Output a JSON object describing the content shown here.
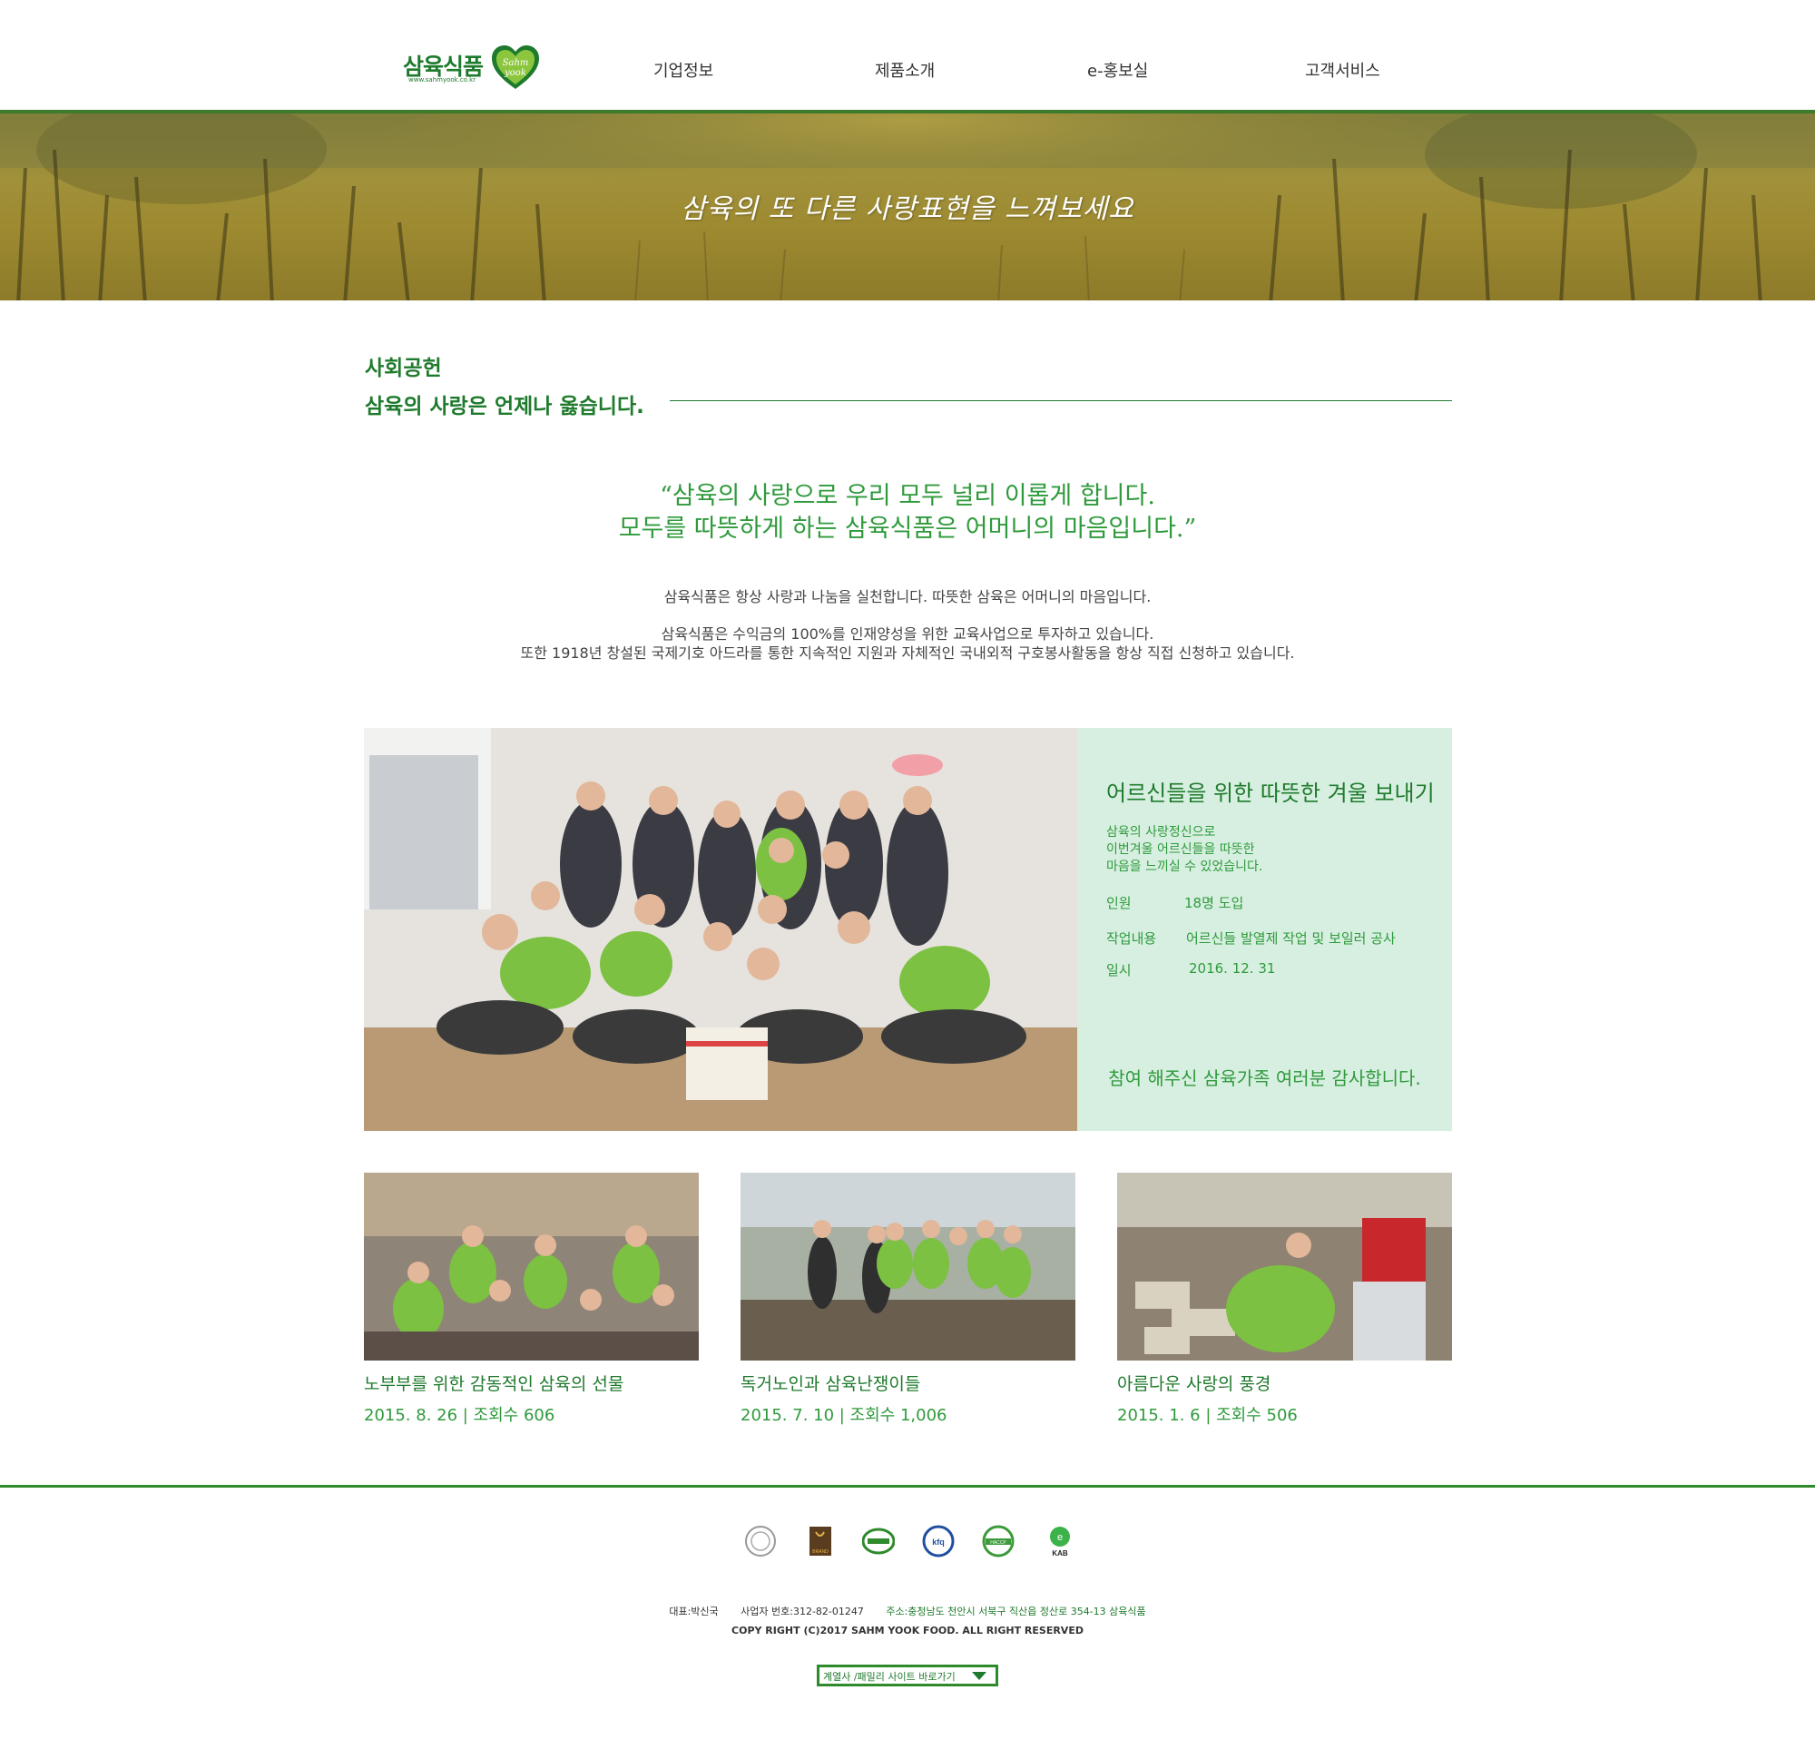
{
  "header": {
    "logo_text": "삼육식품",
    "logo_url": "www.sahmyook.co.kr",
    "logo_badge": "Sahm yook",
    "nav": [
      "기업정보",
      "제품소개",
      "e-홍보실",
      "고객서비스"
    ]
  },
  "banner": {
    "text": "삼육의 또 다른 사랑표현을 느껴보세요"
  },
  "section": {
    "title": "사회공헌",
    "subtitle": "삼육의 사랑은 언제나 옳습니다.",
    "quote_line1": "“삼육의 사랑으로 우리 모두 널리 이롭게 합니다.",
    "quote_line2": "모두를 따뜻하게 하는 삼육식품은 어머니의 마음입니다.”",
    "para1": "삼육식품은 항상 사랑과 나눔을 실천합니다. 따뜻한 삼육은 어머니의 마음입니다.",
    "para2": "삼육식품은 수익금의 100%를 인재양성을 위한 교육사업으로 투자하고 있습니다.",
    "para3": "또한 1918년 창설된 국제기호 아드라를 통한 지속적인 지원과 자체적인 국내외적 구호봉사활동을 항상 직접 신청하고 있습니다."
  },
  "feature": {
    "title": "어르신들을 위한 따뜻한 겨울 보내기",
    "desc_line1": "삼육의 사랑정신으로",
    "desc_line2": "이번겨울 어르신들을 따뜻한",
    "desc_line3": "마음을 느끼실 수 있었습니다.",
    "rows": [
      {
        "label": "인원",
        "value": "18명 도입"
      },
      {
        "label": "작업내용",
        "value": "어르신들 발열제 작업 및 보일러 공사"
      },
      {
        "label": "일시",
        "value": "2016. 12. 31"
      }
    ],
    "thanks": "참여 해주신 삼육가족 여러분 감사합니다."
  },
  "cards": [
    {
      "title": "노부부를 위한 감동적인 삼육의 선물",
      "meta": "2015. 8. 26  |  조회수 606"
    },
    {
      "title": "독거노인과 삼육난쟁이들",
      "meta": "2015. 7. 10  |  조회수 1,006"
    },
    {
      "title": "아름다운 사랑의 풍경",
      "meta": "2015. 1. 6  |  조회수 506"
    }
  ],
  "footer": {
    "certs": [
      "cert-seal-icon",
      "brand-icon",
      "kgc-icon",
      "kfq-icon",
      "haccp-icon",
      "kab-icon"
    ],
    "brand_label": "BRAND",
    "kab_label": "KAB",
    "ceo": "대표:박신국",
    "biz_no": "사업자 번호:312-82-01247",
    "address": "주소:충청남도 천안시 서북구 직산읍 정산로 354-13 삼육식품",
    "copyright": "COPY RIGHT (C)2017 SAHM YOOK FOOD. ALL RIGHT RESERVED",
    "family_label": "계열사 /패밀리 사이트 바로가기"
  },
  "colors": {
    "brand_green": "#1e7a2c",
    "accent_green": "#2f9a3c",
    "feature_bg": "#d7efe0"
  }
}
